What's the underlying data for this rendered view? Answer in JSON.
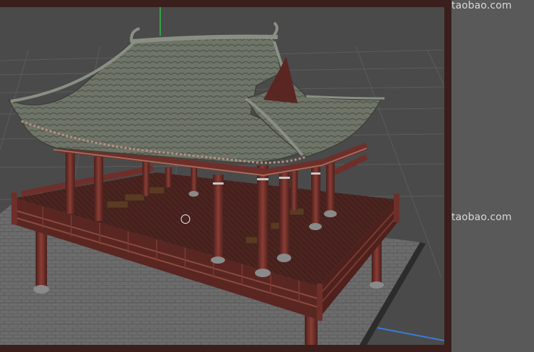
{
  "watermarks": [
    "taobao.com",
    "taobao.com"
  ],
  "colors": {
    "frame": "#3a1f1c",
    "viewport_bg": "#4a4a4a",
    "grid": "#5d5d5d",
    "y_axis": "#2fbf4a",
    "x_axis": "#3a7bd5",
    "roof": "#6d7266",
    "wood": "#6e2f2a",
    "pavement": "#6a6a6a"
  },
  "icons": {
    "viewport_cursor": "circle-cursor-icon"
  }
}
